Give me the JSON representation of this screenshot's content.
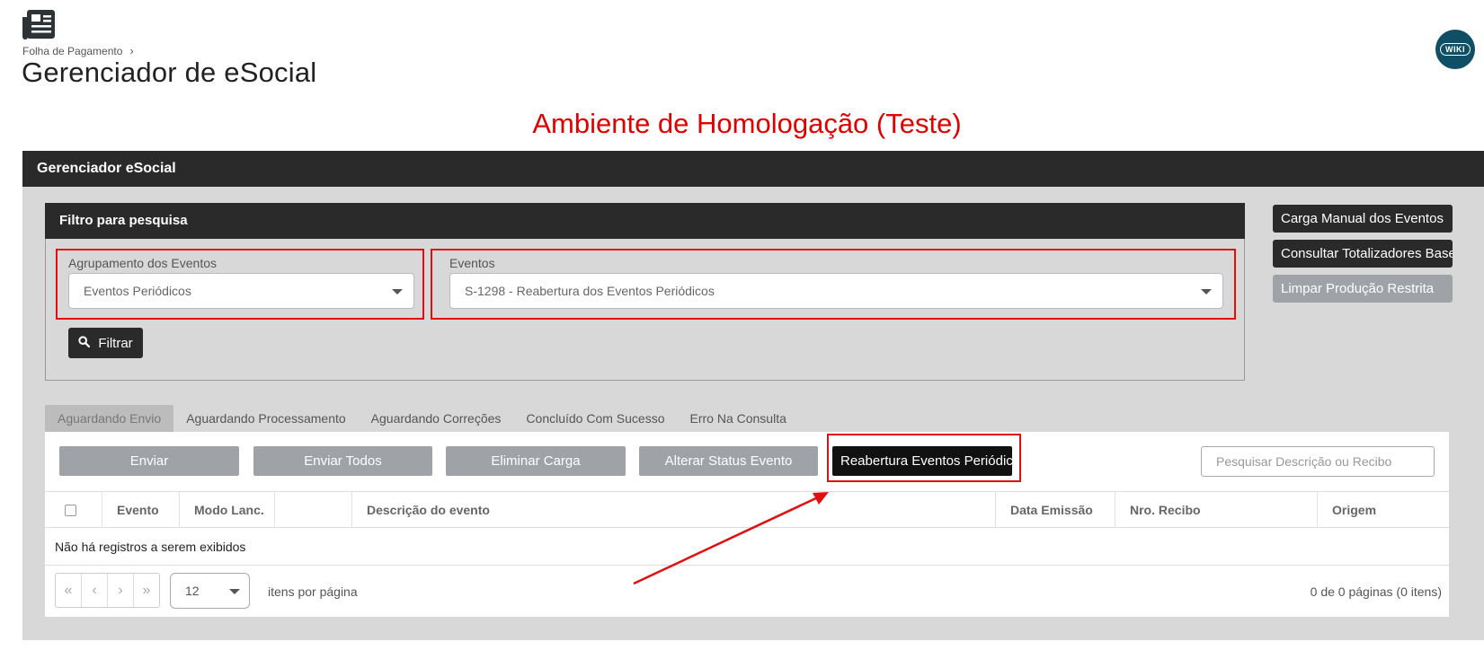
{
  "header": {
    "breadcrumb": "Folha de Pagamento",
    "breadcrumb_separator": "›",
    "title": "Gerenciador de eSocial",
    "wiki_label": "WIKI"
  },
  "environment_banner": "Ambiente de Homologação (Teste)",
  "panel": {
    "title": "Gerenciador eSocial"
  },
  "filter": {
    "title": "Filtro para pesquisa",
    "agrupamento_label": "Agrupamento dos Eventos",
    "agrupamento_value": "Eventos Periódicos",
    "eventos_label": "Eventos",
    "eventos_value": "S-1298 - Reabertura dos Eventos Periódicos",
    "filter_button": "Filtrar"
  },
  "side_buttons": {
    "carga_manual": "Carga Manual dos Eventos",
    "consultar_totalizadores": "Consultar Totalizadores Base",
    "limpar_producao": "Limpar Produção Restrita"
  },
  "tabs": [
    {
      "label": "Aguardando Envio",
      "active": true
    },
    {
      "label": "Aguardando Processamento",
      "active": false
    },
    {
      "label": "Aguardando Correções",
      "active": false
    },
    {
      "label": "Concluído Com Sucesso",
      "active": false
    },
    {
      "label": "Erro Na Consulta",
      "active": false
    }
  ],
  "actions": {
    "enviar": "Enviar",
    "enviar_todos": "Enviar Todos",
    "eliminar_carga": "Eliminar Carga",
    "alterar_status": "Alterar Status Evento",
    "reabertura": "Reabertura Eventos Periódicos"
  },
  "search": {
    "placeholder": "Pesquisar Descrição ou Recibo"
  },
  "table": {
    "columns": [
      "Evento",
      "Modo Lanc.",
      "",
      "Descrição do evento",
      "Data Emissão",
      "Nro. Recibo",
      "Origem"
    ],
    "empty_message": "Não há registros a serem exibidos"
  },
  "pager": {
    "page_size": "12",
    "per_page_label": "itens por página",
    "info": "0 de 0 páginas (0 itens)"
  },
  "colors": {
    "dark_header": "#2a2a2a",
    "highlight_red": "#e01010",
    "disabled_button": "#9fa3a8"
  }
}
